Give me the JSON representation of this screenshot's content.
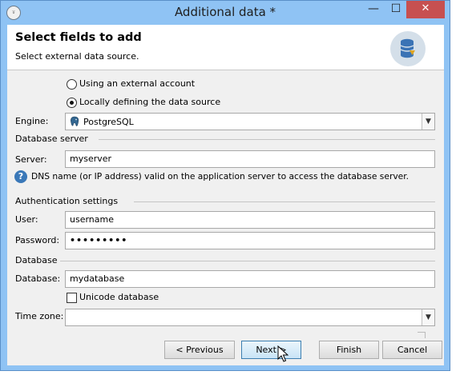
{
  "window": {
    "title": "Additional data *",
    "controls": {
      "minimize": "—",
      "maximize": "☐",
      "close": "✕"
    }
  },
  "header": {
    "title": "Select fields to add",
    "subtitle": "Select external data source.",
    "icon": "database-icon"
  },
  "source": {
    "option_external": "Using an external account",
    "option_local": "Locally defining the data source",
    "selected": "local"
  },
  "engine": {
    "label": "Engine:",
    "value": "PostgreSQL",
    "icon": "postgresql-elephant-icon"
  },
  "database_server": {
    "section": "Database server",
    "server_label": "Server:",
    "server_value": "myserver",
    "help_text": "DNS name (or IP address) valid on the application server to access the database server."
  },
  "authentication": {
    "section": "Authentication settings",
    "user_label": "User:",
    "user_value": "username",
    "password_label": "Password:",
    "password_value": "•••••••••"
  },
  "database": {
    "section": "Database",
    "database_label": "Database:",
    "database_value": "mydatabase",
    "unicode_label": "Unicode database",
    "unicode_checked": false
  },
  "timezone": {
    "label": "Time zone:",
    "value": ""
  },
  "buttons": {
    "previous": "< Previous",
    "next": "Next >",
    "finish": "Finish",
    "cancel": "Cancel"
  }
}
